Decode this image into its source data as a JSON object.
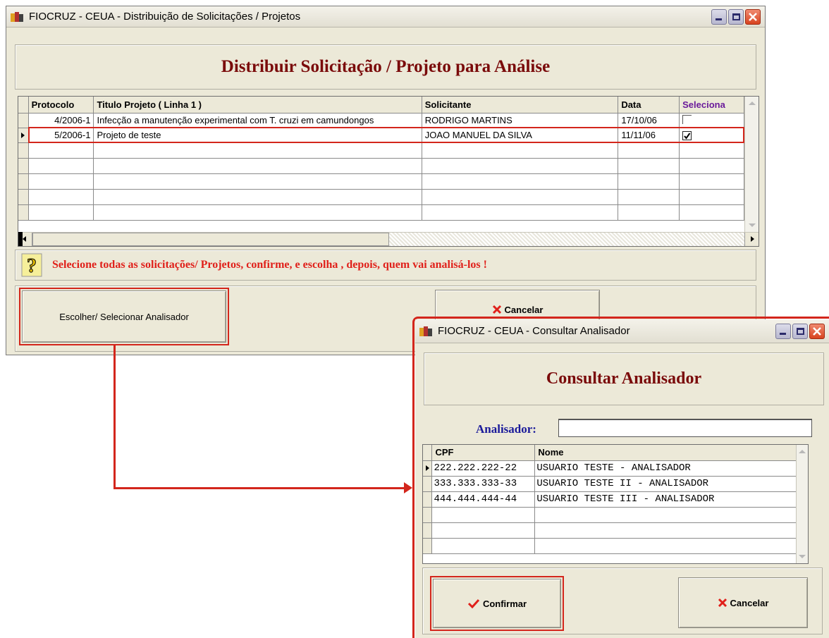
{
  "main_window": {
    "title": "FIOCRUZ - CEUA - Distribuição de Solicitações / Projetos",
    "heading": "Distribuir Solicitação / Projeto para Análise",
    "columns": [
      "Protocolo",
      "Titulo Projeto ( Linha 1 )",
      "Solicitante",
      "Data",
      "Seleciona"
    ],
    "rows": [
      {
        "protocolo": "4/2006-1",
        "titulo": "Infecção a manutenção experimental com T. cruzi em camundongos",
        "solicitante": "RODRIGO MARTINS",
        "data": "17/10/06",
        "selected": false
      },
      {
        "protocolo": "5/2006-1",
        "titulo": "Projeto de teste",
        "solicitante": "JOAO MANUEL DA SILVA",
        "data": "11/11/06",
        "selected": true
      }
    ],
    "hint_text": "Selecione todas as solicitações/ Projetos, confirme, e escolha , depois, quem vai analisá-los !",
    "choose_button": "Escolher/ Selecionar Analisador",
    "cancel_button": "Cancelar"
  },
  "dialog": {
    "title": "FIOCRUZ - CEUA - Consultar Analisador",
    "heading": "Consultar Analisador",
    "field_label": "Analisador:",
    "field_value": "",
    "columns": [
      "CPF",
      "Nome"
    ],
    "rows": [
      {
        "cpf": "222.222.222-22",
        "nome": "USUARIO TESTE - ANALISADOR"
      },
      {
        "cpf": "333.333.333-33",
        "nome": "USUARIO TESTE II - ANALISADOR"
      },
      {
        "cpf": "444.444.444-44",
        "nome": "USUARIO TESTE III - ANALISADOR"
      }
    ],
    "confirm_button": "Confirmar",
    "cancel_button": "Cancelar"
  },
  "colors": {
    "accent_red": "#d3261c",
    "heading_red": "#7a0a0a",
    "label_blue": "#1a1a9a"
  }
}
